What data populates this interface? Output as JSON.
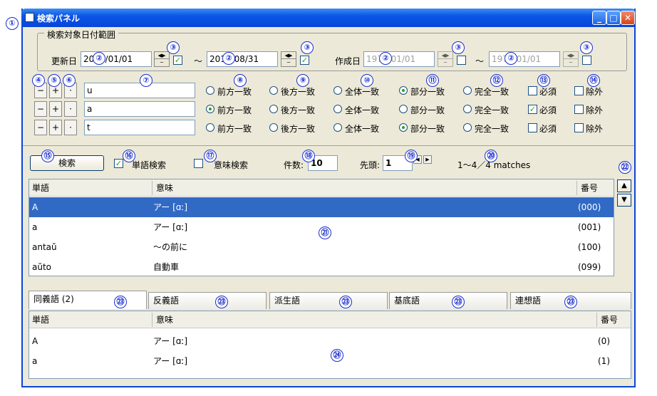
{
  "window": {
    "title": "検索パネル"
  },
  "callouts": [
    "①",
    "②",
    "③",
    "④",
    "⑤",
    "⑥",
    "⑦",
    "⑧",
    "⑨",
    "⑩",
    "⑪",
    "⑫",
    "⑬",
    "⑭",
    "⑮",
    "⑯",
    "⑰",
    "⑱",
    "⑲",
    "⑳",
    "㉑",
    "㉒",
    "㉓",
    "㉔"
  ],
  "date_range": {
    "legend": "検索対象日付範囲",
    "updated_label": "更新日",
    "updated_from": "2012/01/01",
    "updated_to": "2012/08/31",
    "tilde": "～",
    "created_label": "作成日",
    "created_from": "1970/01/01",
    "created_to": "1970/01/01"
  },
  "conditions": {
    "small_buttons": [
      "−",
      "+",
      "·"
    ],
    "rows": [
      {
        "text": "u",
        "match": "部分一致",
        "required": false,
        "exclude": false
      },
      {
        "text": "a",
        "match": "前方一致",
        "required": true,
        "exclude": false
      },
      {
        "text": "t",
        "match": "部分一致",
        "required": false,
        "exclude": false
      }
    ],
    "match_options": [
      "前方一致",
      "後方一致",
      "全体一致",
      "部分一致",
      "完全一致"
    ],
    "required_label": "必須",
    "exclude_label": "除外"
  },
  "search": {
    "button_label": "検索",
    "word_search_label": "単語検索",
    "word_search_checked": true,
    "meaning_search_label": "意味検索",
    "meaning_search_checked": false,
    "count_label": "件数:",
    "count_value": "10",
    "start_label": "先頭:",
    "start_value": "1",
    "result_text": "1～4／4 matches"
  },
  "results": {
    "columns": [
      "単語",
      "意味",
      "番号"
    ],
    "rows": [
      {
        "word": "A",
        "meaning": "アー [ɑː]",
        "number": "(000)",
        "selected": true
      },
      {
        "word": "a",
        "meaning": "アー [ɑː]",
        "number": "(001)",
        "selected": false
      },
      {
        "word": "antaŭ",
        "meaning": "～の前に",
        "number": "(100)",
        "selected": false
      },
      {
        "word": "aŭto",
        "meaning": "自動車",
        "number": "(099)",
        "selected": false
      }
    ]
  },
  "tabs": [
    {
      "label": "同義語 (2)",
      "active": true
    },
    {
      "label": "反義語",
      "active": false
    },
    {
      "label": "派生語",
      "active": false
    },
    {
      "label": "基底語",
      "active": false
    },
    {
      "label": "連想語",
      "active": false
    }
  ],
  "related": {
    "columns": [
      "単語",
      "意味",
      "番号"
    ],
    "rows": [
      {
        "word": "A",
        "meaning": "アー [ɑː]",
        "number": "(0)"
      },
      {
        "word": "a",
        "meaning": "アー [ɑː]",
        "number": "(1)"
      }
    ]
  },
  "scroll": {
    "up": "▲",
    "down": "▼"
  }
}
